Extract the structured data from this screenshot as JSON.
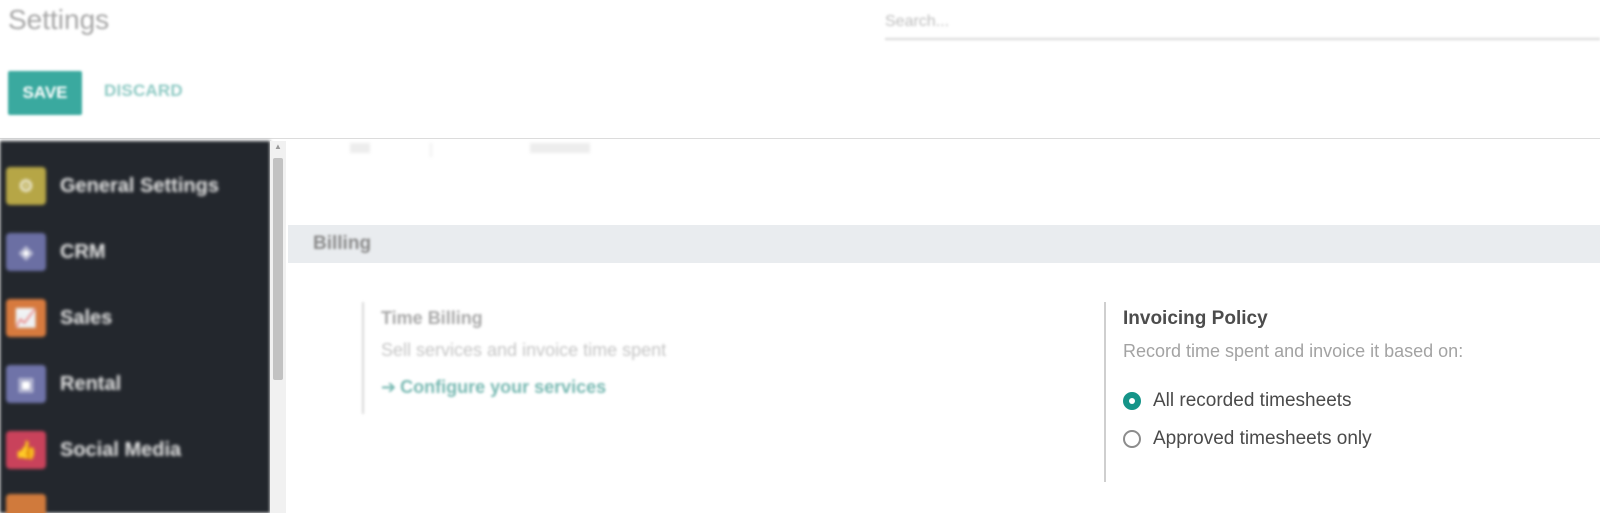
{
  "header": {
    "title": "Settings",
    "search_placeholder": "Search...",
    "save_label": "SAVE",
    "discard_label": "DISCARD"
  },
  "sidebar": {
    "items": [
      {
        "label": "General Settings",
        "icon": "gear-icon",
        "color": "#b6a646"
      },
      {
        "label": "CRM",
        "icon": "handshake-icon",
        "color": "#6b6fa3"
      },
      {
        "label": "Sales",
        "icon": "chart-icon",
        "color": "#d77a3e"
      },
      {
        "label": "Rental",
        "icon": "calendar-icon",
        "color": "#6f73a8"
      },
      {
        "label": "Social Media",
        "icon": "thumbs-up-icon",
        "color": "#c9425b"
      }
    ]
  },
  "billing": {
    "section_title": "Billing",
    "time_billing": {
      "title": "Time Billing",
      "description": "Sell services and invoice time spent",
      "link": "Configure your services"
    },
    "invoicing_policy": {
      "title": "Invoicing Policy",
      "description": "Record time spent and invoice it based on:",
      "options": [
        {
          "label": "All recorded timesheets",
          "selected": true
        },
        {
          "label": "Approved timesheets only",
          "selected": false
        }
      ]
    }
  },
  "colors": {
    "accent": "#159488",
    "save_button": "#3aa99f",
    "sidebar_bg": "#23272d",
    "section_bg": "#e9ecef"
  }
}
